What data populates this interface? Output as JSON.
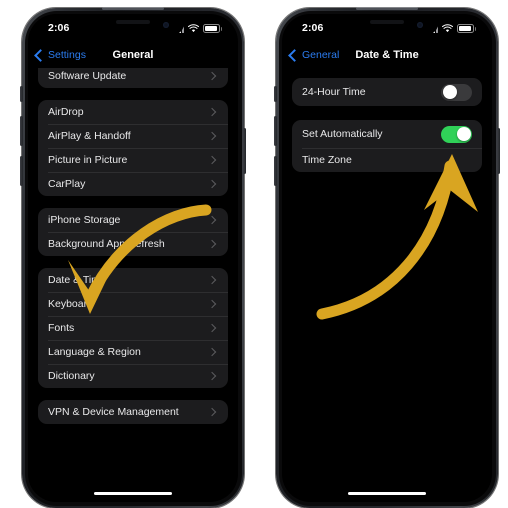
{
  "phones": [
    {
      "id": "left",
      "status_bar": {
        "time": "2:06",
        "signal_icon": "cellular-bars-icon",
        "wifi_icon": "wifi-icon",
        "battery_icon": "battery-icon"
      },
      "nav": {
        "back_label": "Settings",
        "title": "General",
        "back_icon": "chevron-left-icon"
      },
      "groups": [
        {
          "rows": [
            {
              "label": "Software Update",
              "accessory": "chevron"
            }
          ]
        },
        {
          "rows": [
            {
              "label": "AirDrop",
              "accessory": "chevron"
            },
            {
              "label": "AirPlay & Handoff",
              "accessory": "chevron"
            },
            {
              "label": "Picture in Picture",
              "accessory": "chevron"
            },
            {
              "label": "CarPlay",
              "accessory": "chevron"
            }
          ]
        },
        {
          "rows": [
            {
              "label": "iPhone Storage",
              "accessory": "chevron"
            },
            {
              "label": "Background App Refresh",
              "accessory": "chevron"
            }
          ]
        },
        {
          "rows": [
            {
              "label": "Date & Time",
              "accessory": "chevron"
            },
            {
              "label": "Keyboard",
              "accessory": "chevron"
            },
            {
              "label": "Fonts",
              "accessory": "chevron"
            },
            {
              "label": "Language & Region",
              "accessory": "chevron"
            },
            {
              "label": "Dictionary",
              "accessory": "chevron"
            }
          ]
        },
        {
          "rows": [
            {
              "label": "VPN & Device Management",
              "accessory": "chevron"
            }
          ]
        }
      ]
    },
    {
      "id": "right",
      "status_bar": {
        "time": "2:06",
        "signal_icon": "cellular-bars-icon",
        "wifi_icon": "wifi-icon",
        "battery_icon": "battery-icon"
      },
      "nav": {
        "back_label": "General",
        "title": "Date & Time",
        "back_icon": "chevron-left-icon"
      },
      "groups": [
        {
          "rows": [
            {
              "label": "24-Hour Time",
              "accessory": "toggle",
              "toggle_state": "off"
            }
          ]
        },
        {
          "rows": [
            {
              "label": "Set Automatically",
              "accessory": "toggle",
              "toggle_state": "on"
            },
            {
              "label": "Time Zone",
              "accessory": "none"
            }
          ]
        }
      ]
    }
  ],
  "annotations": {
    "arrow_color": "#D9A521",
    "left_arrow_target": "Date & Time",
    "right_arrow_target": "Set Automatically"
  },
  "colors": {
    "accent_blue": "#2B7CF0",
    "toggle_on_green": "#30D158",
    "toggle_off_gray": "#3A3A3C",
    "row_background": "#1C1C1E",
    "screen_background": "#000000",
    "page_background": "#FFFFFF"
  }
}
